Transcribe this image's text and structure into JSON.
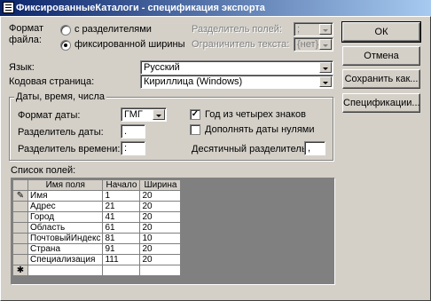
{
  "window": {
    "title": "ФиксированныеКаталоги - спецификация экспорта"
  },
  "format": {
    "label_line1": "Формат",
    "label_line2": "файла:",
    "option_delimited": "с разделителями",
    "option_fixed": "фиксированной ширины",
    "selected": "fixed"
  },
  "field_delimiter": {
    "label": "Разделитель полей:",
    "value": ";"
  },
  "text_qualifier": {
    "label": "Ограничитель текста:",
    "value": "{нет}"
  },
  "language": {
    "label": "Язык:",
    "value": "Русский"
  },
  "codepage": {
    "label": "Кодовая страница:",
    "value": "Кириллица (Windows)"
  },
  "datetime": {
    "group_title": "Даты, время, числа",
    "date_order_label": "Формат даты:",
    "date_order_value": "ГМГ",
    "date_delimiter_label": "Разделитель даты:",
    "date_delimiter_value": ".",
    "time_delimiter_label": "Разделитель времени:",
    "time_delimiter_value": ":",
    "four_digit_years_label": "Год из четырех знаков",
    "four_digit_years_checked": true,
    "leading_zeros_label": "Дополнять даты нулями",
    "leading_zeros_checked": false,
    "decimal_symbol_label": "Десятичный разделитель:",
    "decimal_symbol_value": ","
  },
  "buttons": {
    "ok": "ОК",
    "cancel": "Отмена",
    "save_as": "Сохранить как...",
    "specs": "Спецификации..."
  },
  "field_list": {
    "label": "Список полей:",
    "columns": [
      "Имя поля",
      "Начало",
      "Ширина"
    ],
    "rows": [
      {
        "name": "Имя",
        "start": "1",
        "width": "20"
      },
      {
        "name": "Адрес",
        "start": "21",
        "width": "20"
      },
      {
        "name": "Город",
        "start": "41",
        "width": "20"
      },
      {
        "name": "Область",
        "start": "61",
        "width": "20"
      },
      {
        "name": "ПочтовыйИндекс",
        "start": "81",
        "width": "10"
      },
      {
        "name": "Страна",
        "start": "91",
        "width": "20"
      },
      {
        "name": "Специализация",
        "start": "111",
        "width": "20"
      }
    ],
    "current_row_marker": "✎",
    "new_row_marker": "✱"
  }
}
